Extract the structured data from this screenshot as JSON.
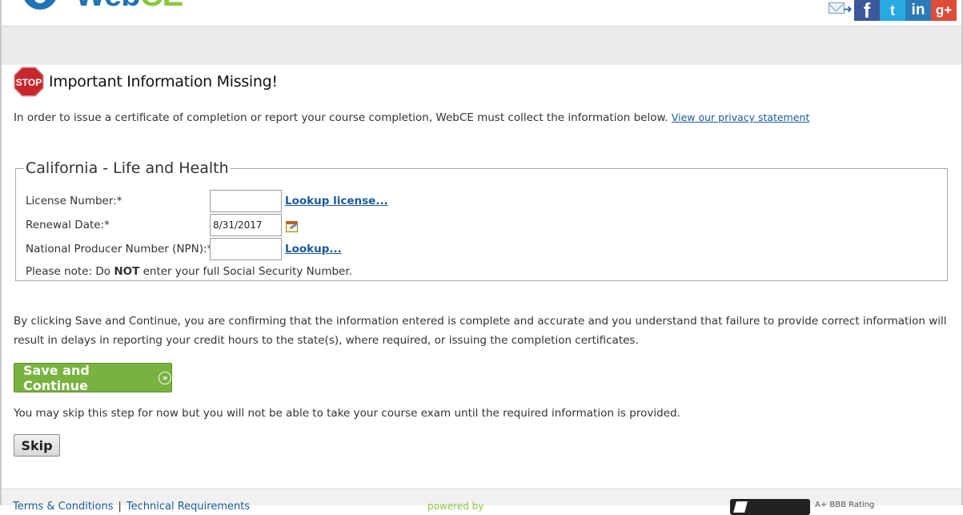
{
  "header": {
    "logo": {
      "text_web": "Web",
      "text_ce": "CE"
    },
    "social": {
      "mail_icon": "mail-share-icon",
      "facebook": "f",
      "twitter": "t",
      "linkedin": "in",
      "googleplus": "g+"
    }
  },
  "alert": {
    "icon": "stop-sign-icon",
    "icon_text": "STOP",
    "title": "Important Information Missing!",
    "intro": "In order to issue a certificate of completion or report your course completion, WebCE must collect the information below.",
    "privacy_link": "View our privacy statement"
  },
  "license_form": {
    "legend": "California - Life and Health",
    "license_label": "License Number:*",
    "license_value": "",
    "license_link": "Lookup license...",
    "renewal_label": "Renewal Date:*",
    "renewal_value": "8/31/2017",
    "calendar_icon": "calendar-icon",
    "npn_label": "National Producer Number (NPN):*",
    "npn_value": "",
    "npn_link": "Lookup...",
    "note_prefix": "Please note: Do ",
    "note_bold": "NOT",
    "note_suffix": " enter your full Social Security Number."
  },
  "confirm_text": "By clicking Save and Continue, you are confirming that the information entered is complete and accurate and you understand that failure to provide correct information will result in delays in reporting your credit hours to the state(s), where required, or issuing the completion certificates.",
  "save_button": "Save and Continue",
  "skip_note": "You may skip this step for now but you will not be able to take your course exam until the required information is provided.",
  "skip_button": "Skip",
  "footer": {
    "link1": "Terms & Conditions",
    "sep": "|",
    "link2": "Technical Requirements",
    "powered": "powered by",
    "bbb_text": "A+ BBB Rating"
  },
  "colors": {
    "brand_blue": "#1f74b5",
    "brand_green": "#8dc63f",
    "button_green": "#79b23f",
    "link_blue": "#1a5a9a",
    "stop_red": "#c9252c"
  }
}
